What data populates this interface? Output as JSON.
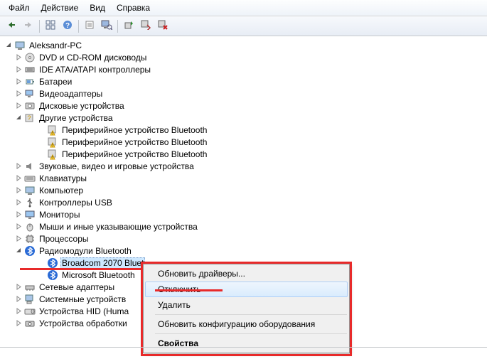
{
  "menu": {
    "file": "Файл",
    "action": "Действие",
    "view": "Вид",
    "help": "Справка"
  },
  "tree": {
    "root": "Aleksandr-PC",
    "dvd": "DVD и CD-ROM дисководы",
    "ide": "IDE ATA/ATAPI контроллеры",
    "battery": "Батареи",
    "video": "Видеоадаптеры",
    "disk": "Дисковые устройства",
    "other": "Другие устройства",
    "bt_per_1": "Периферийное устройство Bluetooth",
    "bt_per_2": "Периферийное устройство Bluetooth",
    "bt_per_3": "Периферийное устройство Bluetooth",
    "sound": "Звуковые, видео и игровые устройства",
    "keyboards": "Клавиатуры",
    "computer": "Компьютер",
    "usb": "Контроллеры USB",
    "monitors": "Мониторы",
    "mice": "Мыши и иные указывающие устройства",
    "cpu": "Процессоры",
    "btradio": "Радиомодули Bluetooth",
    "broadcom": "Broadcom 2070 Bluet",
    "msbt": "Microsoft Bluetooth",
    "netadapt": "Сетевые адаптеры",
    "sysdev": "Системные устройств",
    "hid": "Устройства HID (Huma",
    "proc_dev": "Устройства обработки"
  },
  "context": {
    "update": "Обновить драйверы...",
    "disable": "Отключить",
    "delete": "Удалить",
    "refresh": "Обновить конфигурацию оборудования",
    "properties": "Свойства"
  }
}
